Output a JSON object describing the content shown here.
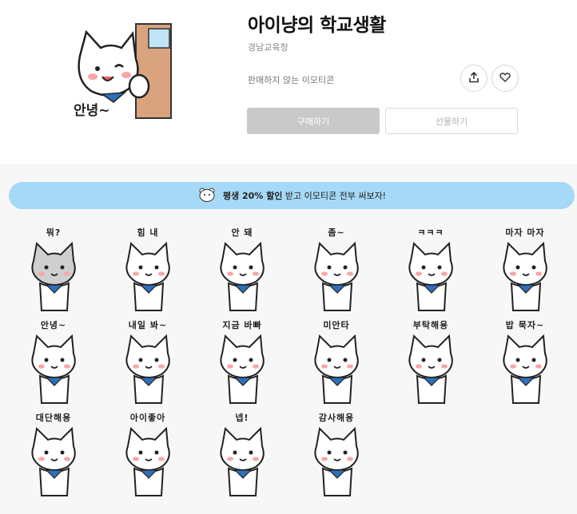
{
  "product": {
    "title": "아이냥의 학교생활",
    "author": "경남교육청",
    "notice": "판매하지 않는 이모티콘",
    "thumbnail_caption": "안녕~"
  },
  "actions": {
    "share_icon": "share-icon",
    "like_icon": "heart-icon",
    "buy_label": "구매하기",
    "gift_label": "선물하기"
  },
  "banner": {
    "highlight": "평생 20% 할인",
    "text": "받고 이모티콘 전부 써보자!"
  },
  "stickers": [
    {
      "caption": "뭐?"
    },
    {
      "caption": "힘 내"
    },
    {
      "caption": "안 돼"
    },
    {
      "caption": "좀~"
    },
    {
      "caption": "ㅋㅋㅋ"
    },
    {
      "caption": "마자 마자"
    },
    {
      "caption": "안녕~"
    },
    {
      "caption": "내일 봐~"
    },
    {
      "caption": "지금 바빠"
    },
    {
      "caption": "미안타"
    },
    {
      "caption": "부탁해용"
    },
    {
      "caption": "밥 묵자~"
    },
    {
      "caption": "대단해용"
    },
    {
      "caption": "아이좋아"
    },
    {
      "caption": "넵!"
    },
    {
      "caption": "감사해용"
    }
  ],
  "colors": {
    "banner_bg": "#a6d9f7",
    "buy_disabled": "#c9c9c9",
    "scarf": "#2f6fb8"
  }
}
